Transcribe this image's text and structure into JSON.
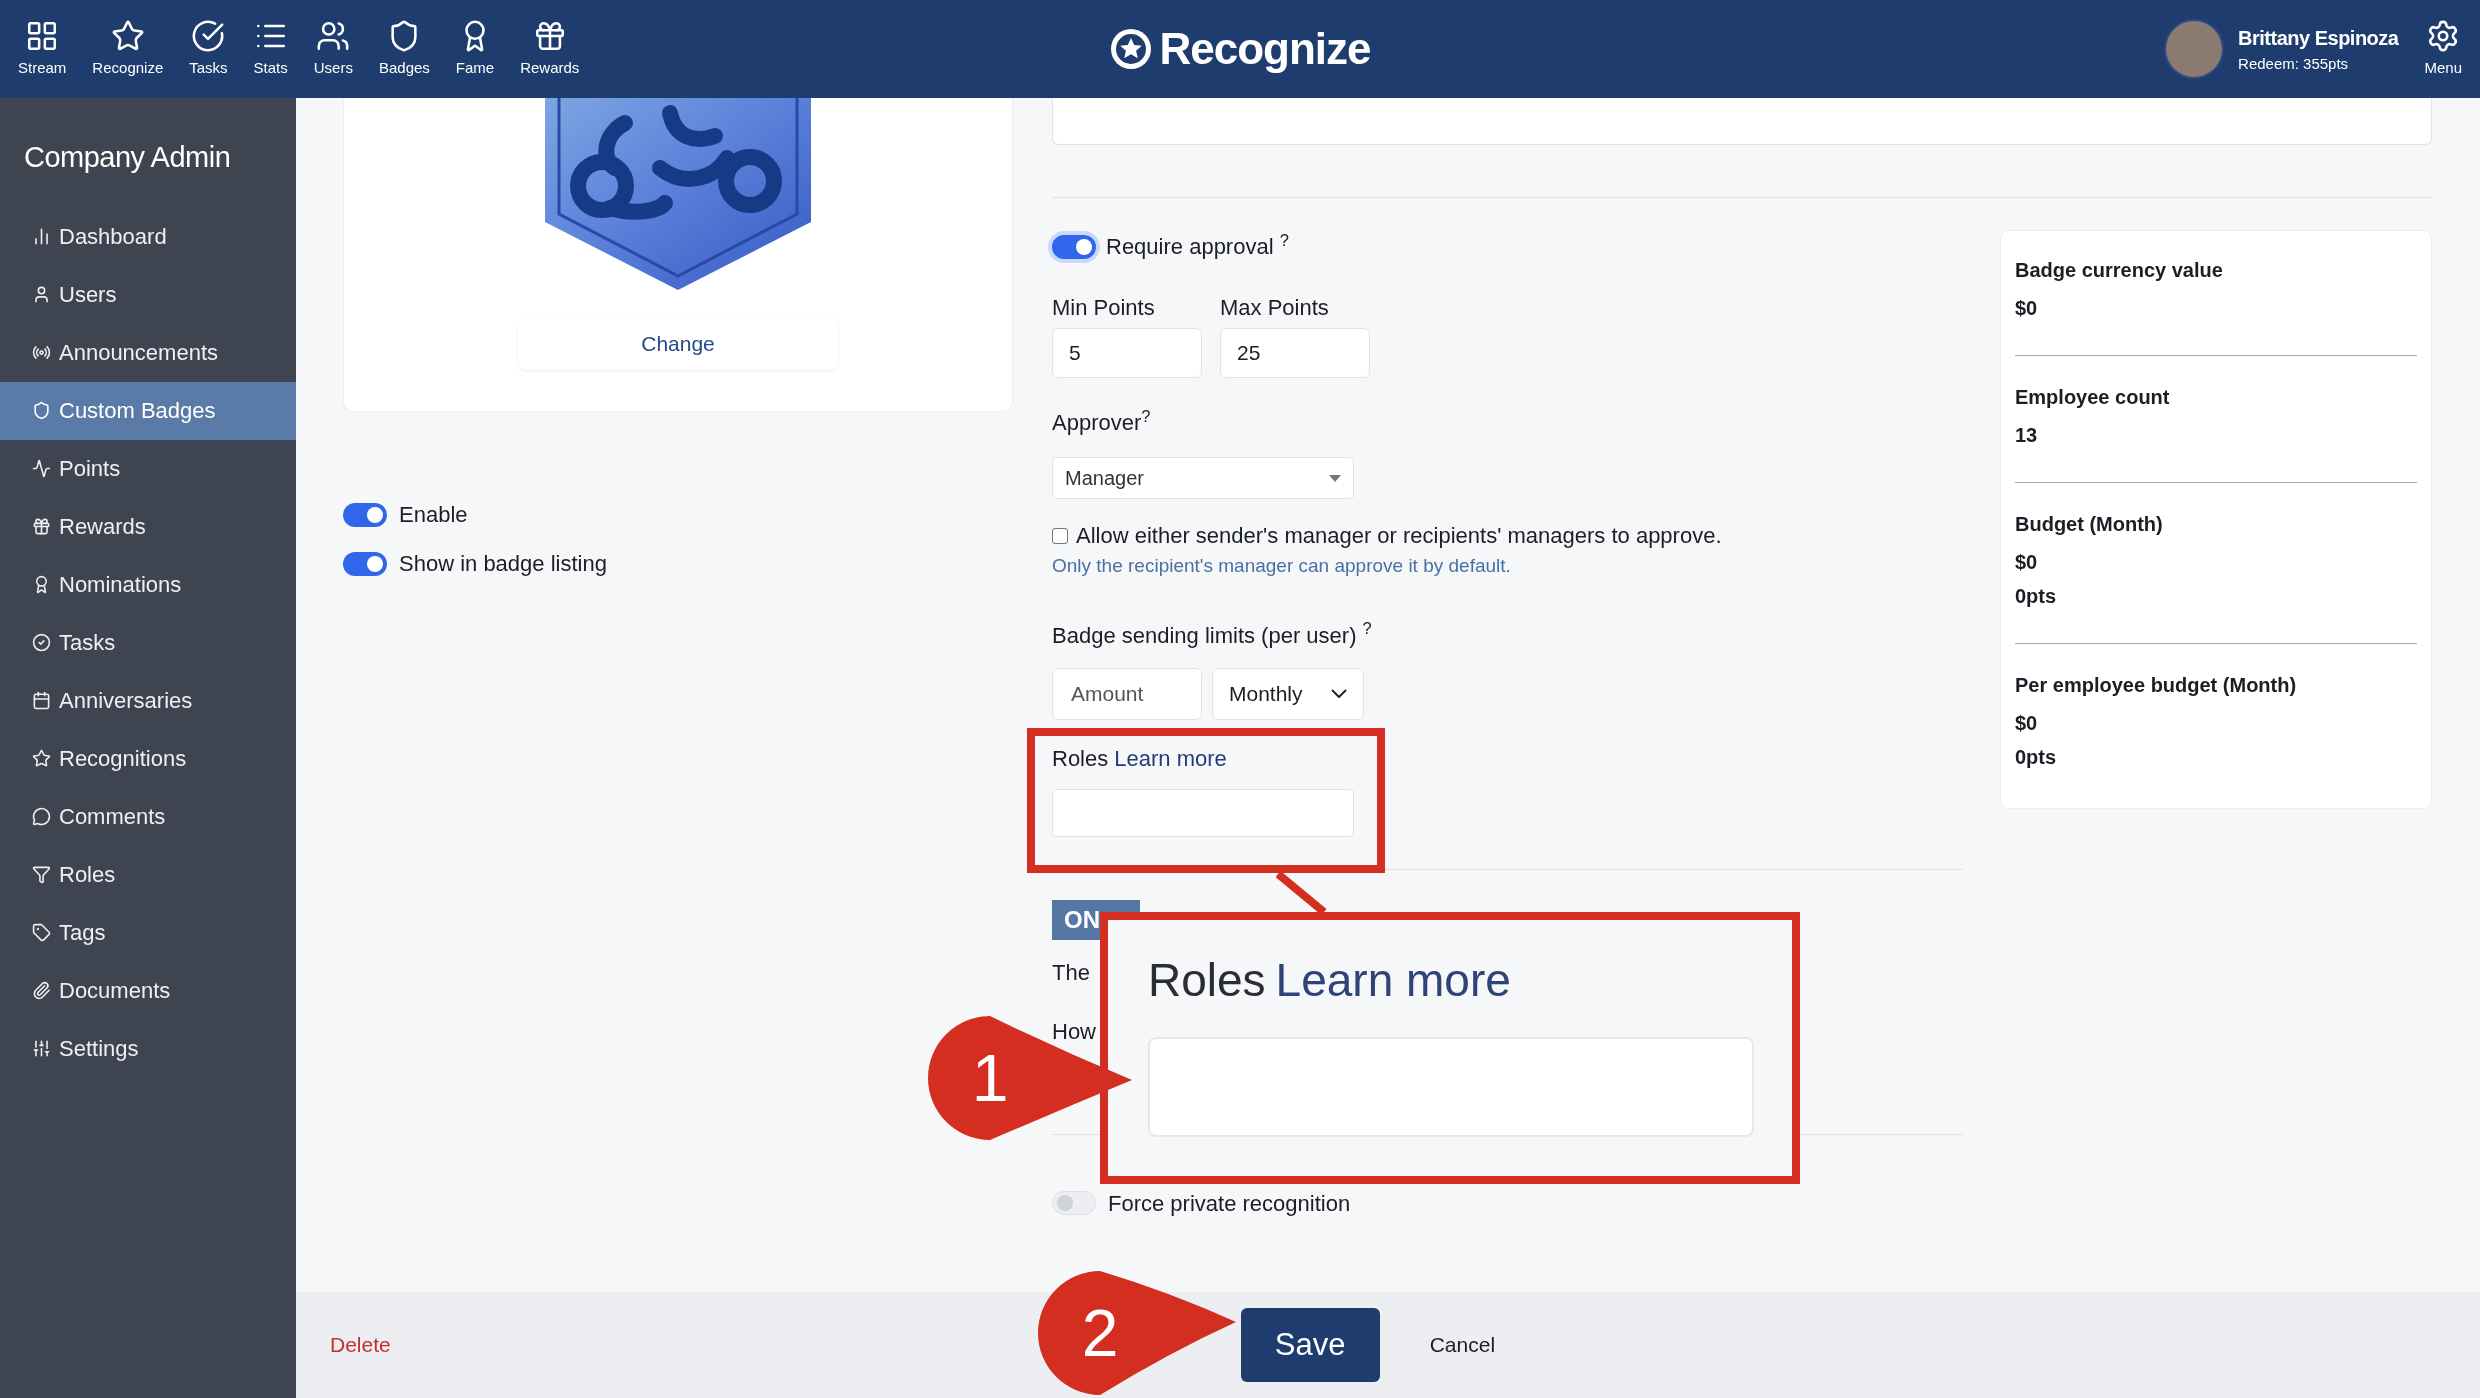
{
  "top_nav": {
    "items": [
      {
        "label": "Stream"
      },
      {
        "label": "Recognize"
      },
      {
        "label": "Tasks"
      },
      {
        "label": "Stats"
      },
      {
        "label": "Users"
      },
      {
        "label": "Badges"
      },
      {
        "label": "Fame"
      },
      {
        "label": "Rewards"
      }
    ],
    "logo": "Recognize",
    "user": {
      "name": "Brittany Espinoza",
      "points": "Redeem: 355pts"
    },
    "menu": "Menu"
  },
  "sidebar": {
    "title": "Company Admin",
    "items": [
      {
        "label": "Dashboard",
        "selected": false
      },
      {
        "label": "Users",
        "selected": false
      },
      {
        "label": "Announcements",
        "selected": false
      },
      {
        "label": "Custom Badges",
        "selected": true
      },
      {
        "label": "Points",
        "selected": false
      },
      {
        "label": "Rewards",
        "selected": false
      },
      {
        "label": "Nominations",
        "selected": false
      },
      {
        "label": "Tasks",
        "selected": false
      },
      {
        "label": "Anniversaries",
        "selected": false
      },
      {
        "label": "Recognitions",
        "selected": false
      },
      {
        "label": "Comments",
        "selected": false
      },
      {
        "label": "Roles",
        "selected": false
      },
      {
        "label": "Tags",
        "selected": false
      },
      {
        "label": "Documents",
        "selected": false
      },
      {
        "label": "Settings",
        "selected": false
      }
    ]
  },
  "badge_card": {
    "change_button": "Change"
  },
  "badge_toggles": [
    {
      "label": "Enable",
      "on": true
    },
    {
      "label": "Show in badge listing",
      "on": true
    }
  ],
  "form": {
    "require_approval": {
      "label": "Require approval $^{?}$",
      "on": true
    },
    "min_points": {
      "label": "Min Points",
      "value": "5"
    },
    "max_points": {
      "label": "Max Points",
      "value": "25"
    },
    "approver": {
      "label": "Approver$^{?}$",
      "value": "Manager"
    },
    "allow_either": {
      "label": "Allow either sender's manager or recipients' managers to approve.",
      "checked": false,
      "help": "Only the recipient's manager can approve it by default."
    },
    "sending_limits": {
      "label": "Badge sending limits (per user) $^{?}$",
      "amount_placeholder": "Amount",
      "period": "Monthly"
    },
    "roles": {
      "label": "Roles",
      "link": "Learn more"
    },
    "on_tag": "ON",
    "partial_line_1": "The",
    "partial_line_2": "How",
    "force_private": {
      "label": "Force private recognition",
      "on": false
    }
  },
  "budget_panel": [
    {
      "title": "Badge currency value",
      "values": [
        "$0"
      ]
    },
    {
      "title": "Employee count",
      "values": [
        "13"
      ]
    },
    {
      "title": "Budget (Month)",
      "values": [
        "$0",
        "0pts"
      ]
    },
    {
      "title": "Per employee budget (Month)",
      "values": [
        "$0",
        "0pts"
      ]
    }
  ],
  "footer": {
    "delete": "Delete",
    "save": "Save",
    "cancel": "Cancel"
  },
  "zoom_callout": {
    "label": "Roles",
    "link": "Learn more"
  },
  "annotations": [
    {
      "number": "1"
    },
    {
      "number": "2"
    }
  ]
}
